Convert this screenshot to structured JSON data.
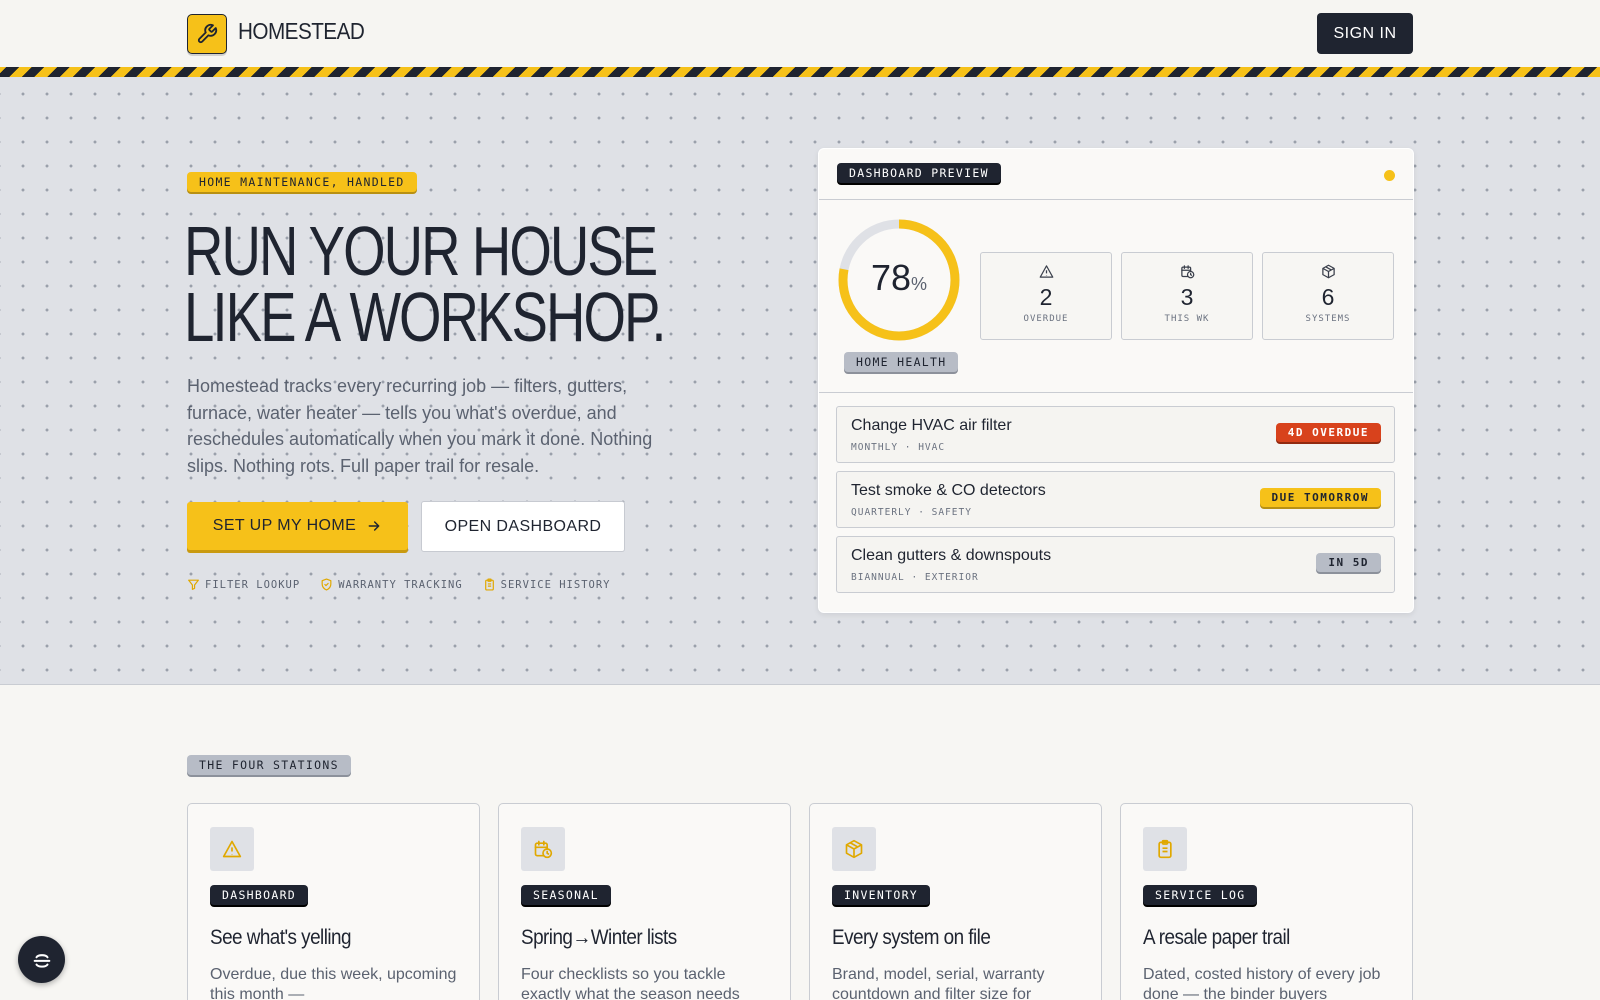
{
  "header": {
    "brand": "HOMESTEAD",
    "signin_label": "SIGN IN",
    "logo_icon": "wrench-icon"
  },
  "hero": {
    "tag": "HOME MAINTENANCE, HANDLED",
    "title_line1": "RUN YOUR HOUSE",
    "title_line2": "LIKE A WORKSHOP.",
    "description": "Homestead tracks every recurring job — filters, gutters, furnace, water heater — tells you what's overdue, and reschedules automatically when you mark it done. Nothing slips. Nothing rots. Full paper trail for resale.",
    "primary_button": "SET UP MY HOME",
    "secondary_button": "OPEN DASHBOARD",
    "features": [
      {
        "icon": "filter-icon",
        "label": "FILTER LOOKUP"
      },
      {
        "icon": "shield-check-icon",
        "label": "WARRANTY TRACKING"
      },
      {
        "icon": "clipboard-icon",
        "label": "SERVICE HISTORY"
      }
    ]
  },
  "dashboard": {
    "tag": "DASHBOARD PREVIEW",
    "health_value": "78",
    "health_unit": "%",
    "health_fraction": 0.78,
    "health_label": "HOME HEALTH",
    "stats": [
      {
        "icon": "alert-triangle-icon",
        "value": "2",
        "label": "OVERDUE"
      },
      {
        "icon": "calendar-clock-icon",
        "value": "3",
        "label": "THIS WK"
      },
      {
        "icon": "box-icon",
        "value": "6",
        "label": "SYSTEMS"
      }
    ],
    "tasks": [
      {
        "title": "Change HVAC air filter",
        "meta": "MONTHLY · HVAC",
        "badge": "4D OVERDUE",
        "status": "overdue"
      },
      {
        "title": "Test smoke & CO detectors",
        "meta": "QUARTERLY · SAFETY",
        "badge": "DUE TOMORROW",
        "status": "soon"
      },
      {
        "title": "Clean gutters & downspouts",
        "meta": "BIANNUAL · EXTERIOR",
        "badge": "IN 5D",
        "status": "later"
      }
    ]
  },
  "stations": {
    "tag": "THE FOUR STATIONS",
    "cards": [
      {
        "icon": "alert-triangle-icon",
        "tag": "DASHBOARD",
        "title": "See what's yelling",
        "text": "Overdue, due this week, upcoming this month —"
      },
      {
        "icon": "calendar-clock-icon",
        "tag": "SEASONAL",
        "title": "Spring→Winter lists",
        "text": "Four checklists so you tackle exactly what the season needs"
      },
      {
        "icon": "box-icon",
        "tag": "INVENTORY",
        "title": "Every system on file",
        "text": "Brand, model, serial, warranty countdown and filter size for"
      },
      {
        "icon": "clipboard-icon",
        "tag": "SERVICE LOG",
        "title": "A resale paper trail",
        "text": "Dated, costed history of every job done — the binder buyers"
      }
    ]
  },
  "colors": {
    "accent": "#f6c119",
    "dark": "#1f2430",
    "overdue": "#d8421c",
    "muted": "#b7bcc6"
  }
}
